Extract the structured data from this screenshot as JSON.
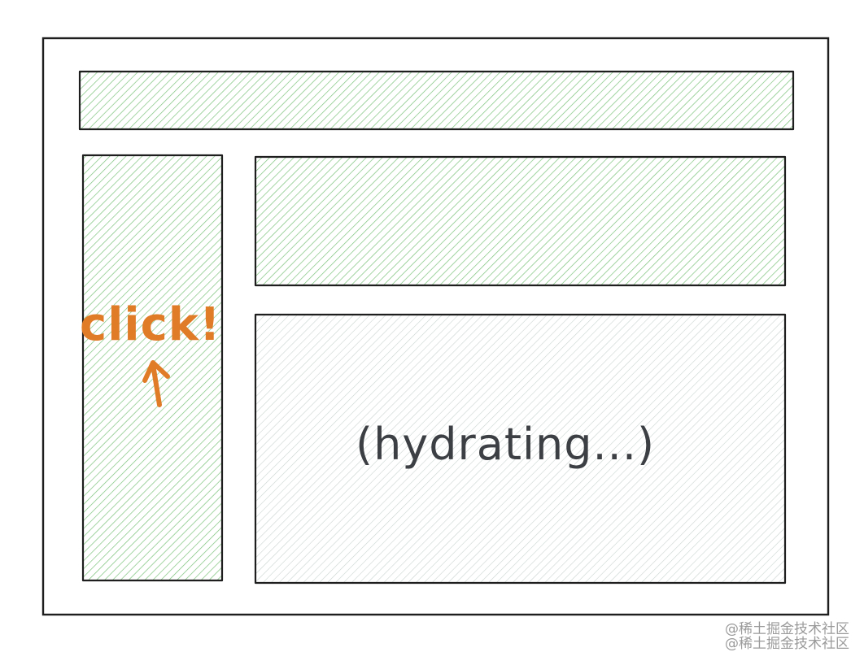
{
  "diagram": {
    "annotation": {
      "label": "click!",
      "color": "#e07b27"
    },
    "status": {
      "label": "(hydrating...)",
      "color": "#3c3f43"
    },
    "colors": {
      "hydrated_hatch": "#7cc27c",
      "pending_hatch": "#c9d3cf",
      "outline": "#1e1e1e"
    }
  },
  "watermark": {
    "line1": "@稀土掘金技术社区",
    "line2": "@稀土掘金技术社区"
  }
}
